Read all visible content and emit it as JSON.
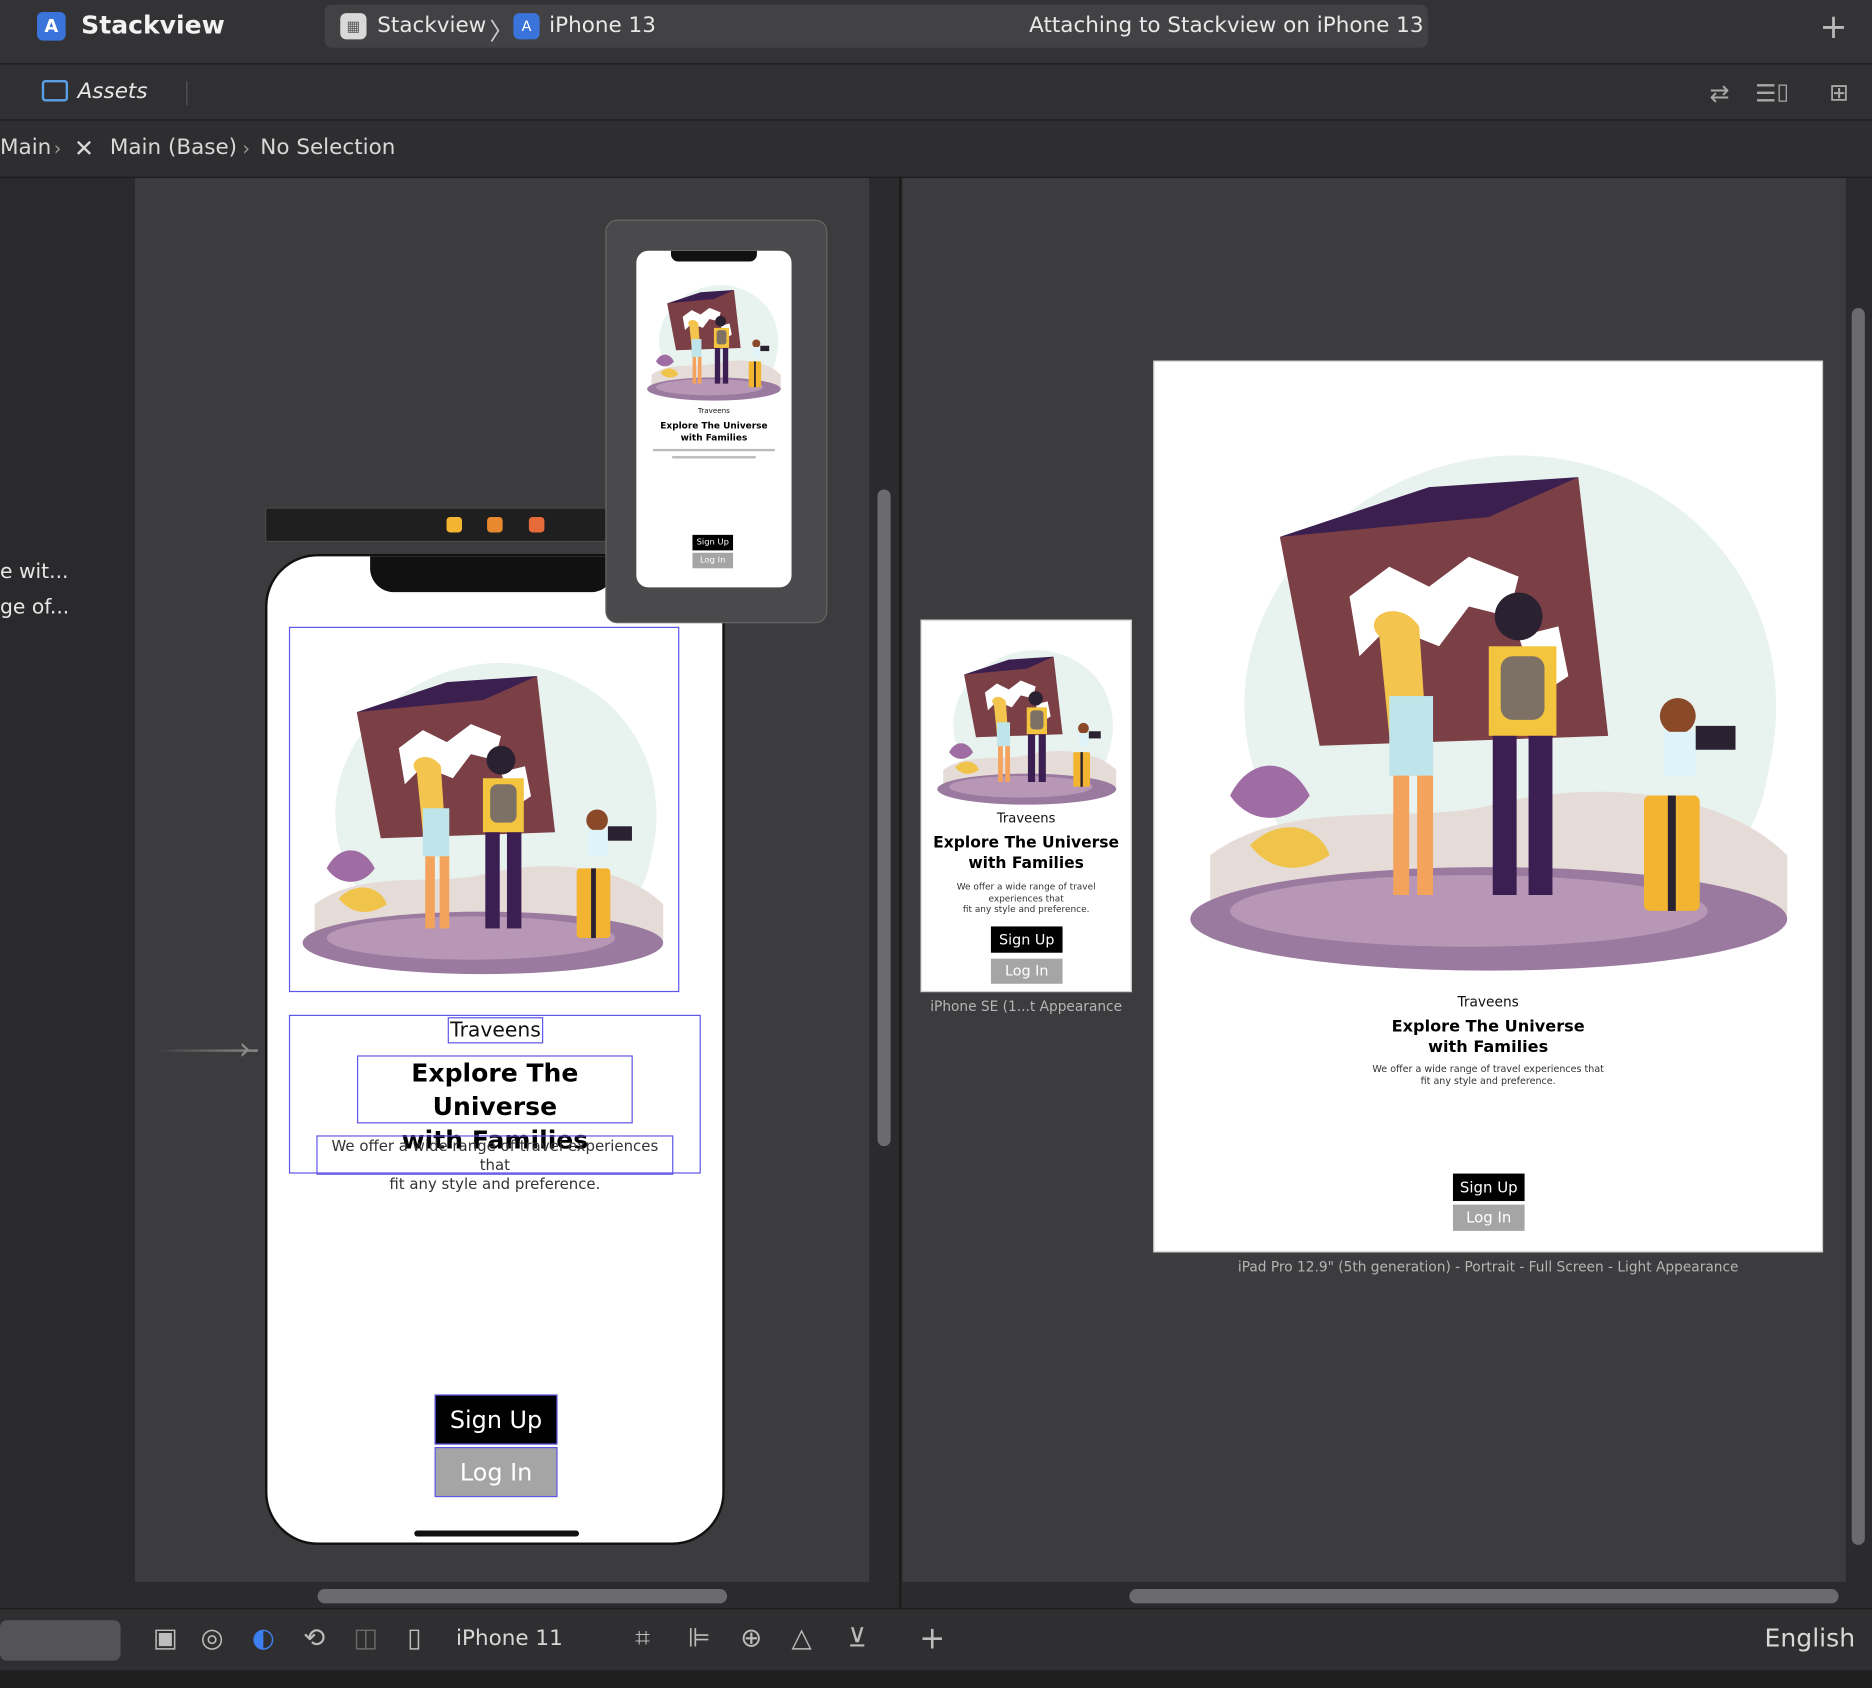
{
  "window": {
    "app_name": "Stackview",
    "scheme_target": "Stackview",
    "scheme_device": "iPhone 13",
    "status": "Attaching to Stackview on iPhone 13"
  },
  "tab": {
    "label": "Assets"
  },
  "breadcrumb": {
    "items": [
      "Main",
      "Main (Base)",
      "No Selection"
    ]
  },
  "outline": {
    "rows": [
      "e wit...",
      "ge of..."
    ]
  },
  "app_screen": {
    "brand": "Traveens",
    "headline_line1": "Explore The Universe",
    "headline_line2": "with Families",
    "body_line1": "We offer a wide range of travel experiences that",
    "body_line2": "fit any style and preference.",
    "sign_up": "Sign Up",
    "log_in": "Log In"
  },
  "se_preview": {
    "brand": "Traveens",
    "headline_line1": "Explore The Universe",
    "headline_line2": "with Families",
    "body_line1": "We offer a wide range of travel",
    "body_line2": "experiences that",
    "body_line3": "fit any style and preference.",
    "sign_up": "Sign Up",
    "log_in": "Log In",
    "caption": "iPhone SE (1...t Appearance"
  },
  "ipad_preview": {
    "brand": "Traveens",
    "headline_line1": "Explore The Universe",
    "headline_line2": "with Families",
    "body_line1": "We offer a wide range of travel experiences that",
    "body_line2": "fit any style and preference.",
    "sign_up": "Sign Up",
    "log_in": "Log In",
    "caption": "iPad Pro 12.9\" (5th generation) - Portrait - Full Screen - Light Appearance"
  },
  "mini_preview": {
    "brand": "Traveens",
    "headline_line1": "Explore The Universe",
    "headline_line2": "with Families",
    "sign_up": "Sign Up",
    "log_in": "Log In"
  },
  "bottom_toolbar": {
    "device": "iPhone 11",
    "language": "English"
  },
  "colors": {
    "accent_blue": "#3a73d9",
    "selection": "#5d55e8",
    "map_brown": "#7b3f46",
    "map_purple": "#3a1f4f",
    "suitcase": "#f2b431"
  }
}
